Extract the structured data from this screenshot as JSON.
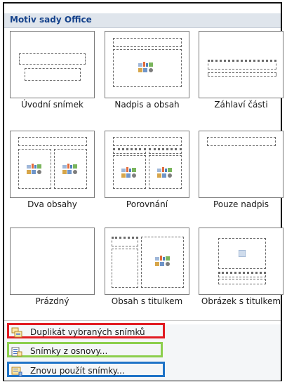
{
  "panel": {
    "title": "Motiv sady Office"
  },
  "layouts": [
    {
      "label": "Úvodní snímek"
    },
    {
      "label": "Nadpis a obsah"
    },
    {
      "label": "Záhlaví části"
    },
    {
      "label": "Dva obsahy"
    },
    {
      "label": "Porovnání"
    },
    {
      "label": "Pouze nadpis"
    },
    {
      "label": "Prázdný"
    },
    {
      "label": "Obsah s titulkem"
    },
    {
      "label": "Obrázek s titulkem"
    }
  ],
  "menu": {
    "duplicate": {
      "label": "Duplikát vybraných snímků",
      "icon": "duplicate-slides-icon",
      "highlight": "#e11b22"
    },
    "from_outline": {
      "label": "Snímky z osnovy...",
      "icon": "slides-from-outline-icon",
      "highlight": "#8ccf4d"
    },
    "reuse": {
      "label": "Znovu použít snímky...",
      "icon": "reuse-slides-icon",
      "highlight": "#1f73c7"
    }
  }
}
